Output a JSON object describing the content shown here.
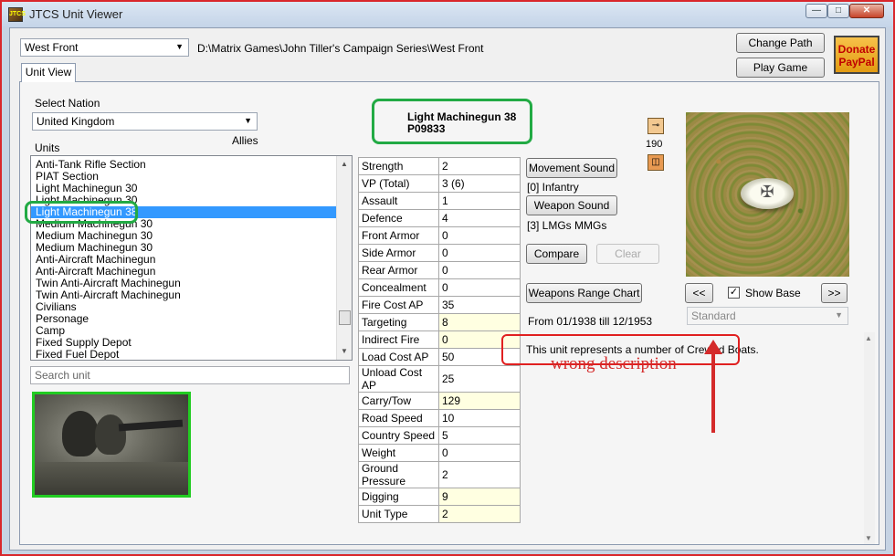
{
  "window": {
    "title": "JTCS Unit Viewer",
    "app_icon_text": "JTCS"
  },
  "top": {
    "game_select": "West Front",
    "game_path": "D:\\Matrix Games\\John Tiller's Campaign Series\\West Front",
    "change_path_label": "Change Path",
    "play_game_label": "Play Game",
    "donate_line1": "Donate",
    "donate_line2": "PayPal"
  },
  "tab": {
    "label": "Unit View"
  },
  "nation": {
    "label": "Select Nation",
    "value": "United Kingdom",
    "side": "Allies"
  },
  "units": {
    "label": "Units",
    "items": [
      "Anti-Tank Rifle Section",
      "PIAT Section",
      "Light Machinegun 30",
      "Light Machinegun 30",
      "Light Machinegun 38",
      "Medium Machinegun 30",
      "Medium Machinegun 30",
      "Medium Machinegun 30",
      "Anti-Aircraft Machinegun",
      "Anti-Aircraft Machinegun",
      "Twin Anti-Aircraft Machinegun",
      "Twin Anti-Aircraft Machinegun",
      "Civilians",
      "Personage",
      "Camp",
      "Fixed Supply Depot",
      "Fixed Fuel Depot"
    ],
    "selected_index": 4,
    "search_placeholder": "Search unit"
  },
  "unit": {
    "name": "Light Machinegun 38",
    "code": "P09833",
    "icon_value": "190"
  },
  "stats": [
    {
      "k": "Strength",
      "v": "2",
      "hl": false
    },
    {
      "k": "VP (Total)",
      "v": "3 (6)",
      "hl": false
    },
    {
      "k": "Assault",
      "v": "1",
      "hl": false
    },
    {
      "k": "Defence",
      "v": "4",
      "hl": false
    },
    {
      "k": "Front Armor",
      "v": "0",
      "hl": false
    },
    {
      "k": "Side Armor",
      "v": "0",
      "hl": false
    },
    {
      "k": "Rear Armor",
      "v": "0",
      "hl": false
    },
    {
      "k": "Concealment",
      "v": "0",
      "hl": false
    },
    {
      "k": "Fire Cost AP",
      "v": "35",
      "hl": false
    },
    {
      "k": "Targeting",
      "v": "8",
      "hl": true
    },
    {
      "k": "Indirect Fire",
      "v": "0",
      "hl": true
    },
    {
      "k": "Load Cost AP",
      "v": "50",
      "hl": false
    },
    {
      "k": "Unload Cost AP",
      "v": "25",
      "hl": false
    },
    {
      "k": "Carry/Tow",
      "v": "129",
      "hl": true
    },
    {
      "k": "Road Speed",
      "v": "10",
      "hl": false
    },
    {
      "k": "Country Speed",
      "v": "5",
      "hl": false
    },
    {
      "k": "Weight",
      "v": "0",
      "hl": false
    },
    {
      "k": "Ground Pressure",
      "v": "2",
      "hl": false
    },
    {
      "k": "Digging",
      "v": "9",
      "hl": true
    },
    {
      "k": "Unit Type",
      "v": "2",
      "hl": true
    }
  ],
  "sound": {
    "movement_label": "Movement Sound",
    "movement_type": "[0] Infantry",
    "weapon_label": "Weapon Sound",
    "weapon_type": "[3] LMGs MMGs"
  },
  "actions": {
    "compare_label": "Compare",
    "clear_label": "Clear",
    "range_chart_label": "Weapons Range Chart"
  },
  "dates": "From 01/1938 till 12/1953",
  "description": "This unit represents a number of Crewed Boats.",
  "preview": {
    "prev_label": "<<",
    "next_label": ">>",
    "show_base_label": "Show Base",
    "show_base_checked": "✓",
    "style_select": "Standard"
  },
  "annotation": {
    "text": "wrong description",
    "color": "#d42a2a"
  },
  "colors": {
    "selection": "#3399ff",
    "highlight_box": "#22aa44",
    "annotation_box": "#e02020"
  }
}
